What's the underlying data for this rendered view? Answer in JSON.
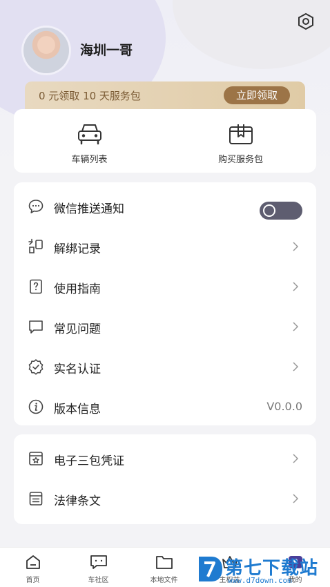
{
  "profile": {
    "username": "海圳一哥"
  },
  "promo": {
    "text": "0 元领取 10 天服务包",
    "button": "立即领取"
  },
  "quick_actions": [
    {
      "label": "车辆列表",
      "icon": "car-icon"
    },
    {
      "label": "购买服务包",
      "icon": "gift-box-icon"
    }
  ],
  "menu_group1": [
    {
      "label": "微信推送通知",
      "icon": "chat-bubble-icon",
      "control": "toggle",
      "toggle_on": false
    },
    {
      "label": "解绑记录",
      "icon": "unbind-icon",
      "control": "chevron"
    },
    {
      "label": "使用指南",
      "icon": "question-doc-icon",
      "control": "chevron"
    },
    {
      "label": "常见问题",
      "icon": "faq-bubble-icon",
      "control": "chevron"
    },
    {
      "label": "实名认证",
      "icon": "verified-badge-icon",
      "control": "chevron"
    },
    {
      "label": "版本信息",
      "icon": "info-icon",
      "control": "value",
      "value": "V0.0.0"
    }
  ],
  "menu_group2": [
    {
      "label": "电子三包凭证",
      "icon": "certificate-icon",
      "control": "chevron"
    },
    {
      "label": "法律条文",
      "icon": "document-icon",
      "control": "chevron"
    }
  ],
  "tabbar": [
    {
      "label": "首页",
      "icon": "home-icon"
    },
    {
      "label": "车社区",
      "icon": "community-icon"
    },
    {
      "label": "本地文件",
      "icon": "folder-icon"
    },
    {
      "label": "主权益",
      "icon": "crown-icon"
    },
    {
      "label": "我的",
      "icon": "profile-icon"
    }
  ],
  "watermark": {
    "text": "第七下载站",
    "url": "www.d7down.com"
  },
  "colors": {
    "accent_gold": "#9c7447",
    "toggle_bg": "#5e5d70",
    "background": "#f3f3f6",
    "watermark_blue": "#1f7bd0"
  }
}
